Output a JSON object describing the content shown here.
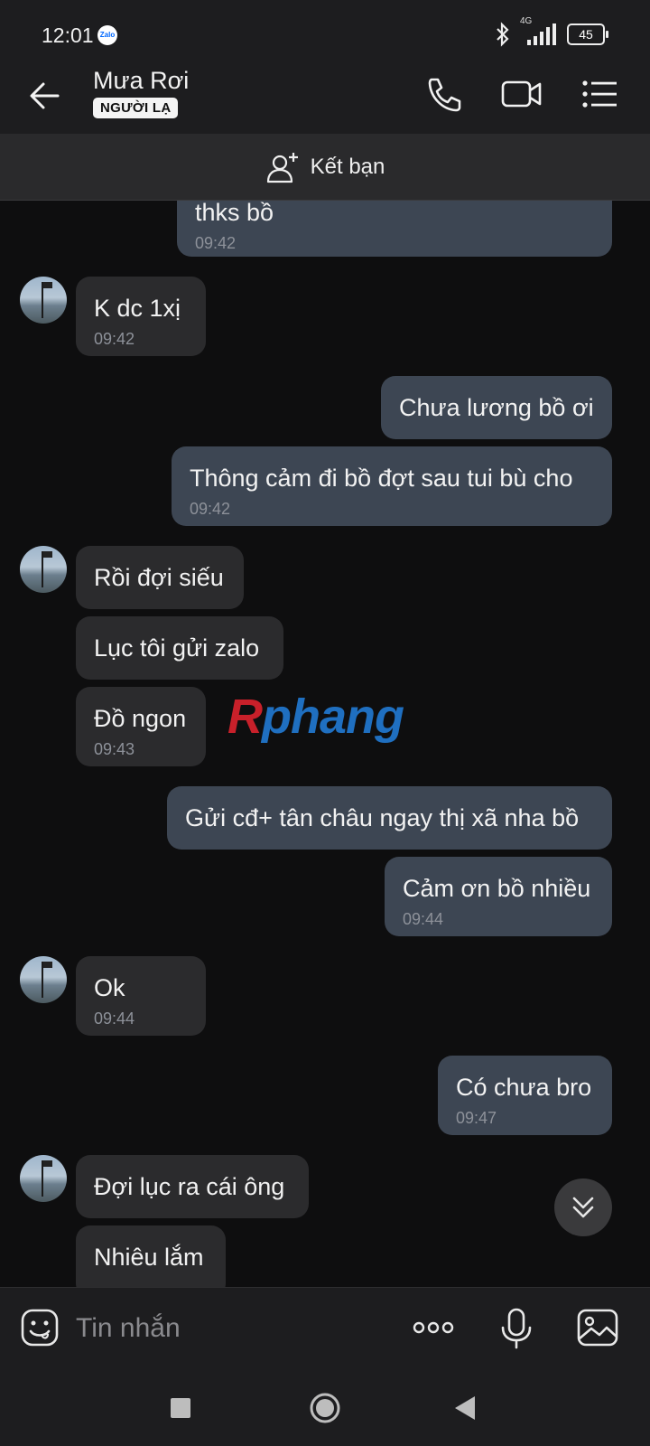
{
  "status_bar": {
    "time": "12:01",
    "zalo_label": "Zalo",
    "network": "4G",
    "battery": "45"
  },
  "header": {
    "contact_name": "Mưa Rơi",
    "stranger_badge": "NGƯỜI LẠ",
    "icons": [
      "back-arrow-icon",
      "phone-icon",
      "video-call-icon",
      "menu-list-icon"
    ]
  },
  "add_friend": {
    "label": "Kết bạn",
    "icon": "add-person-icon"
  },
  "messages": [
    {
      "dir": "out",
      "text": "thks bồ",
      "time": "09:42"
    },
    {
      "dir": "in",
      "text": "K dc 1xị",
      "time": "09:42"
    },
    {
      "dir": "out",
      "text": "Chưa lương bồ ơi",
      "time": ""
    },
    {
      "dir": "out",
      "text": "Thông cảm đi bồ đợt sau tui bù cho",
      "time": "09:42"
    },
    {
      "dir": "in",
      "text": "Rồi đợi siếu",
      "time": ""
    },
    {
      "dir": "in",
      "text": "Lục tôi gửi zalo",
      "time": ""
    },
    {
      "dir": "in",
      "text": "Đồ ngon",
      "time": "09:43"
    },
    {
      "dir": "out",
      "text": "Gửi cđ+ tân châu ngay thị xã nha bồ",
      "time": ""
    },
    {
      "dir": "out",
      "text": "Cảm ơn bồ nhiều",
      "time": "09:44"
    },
    {
      "dir": "in",
      "text": "Ok",
      "time": "09:44"
    },
    {
      "dir": "out",
      "text": "Có chưa bro",
      "time": "09:47"
    },
    {
      "dir": "in",
      "text": "Đợi lục ra cái ông",
      "time": ""
    },
    {
      "dir": "in",
      "text": "Nhiêu lắm",
      "time": ""
    }
  ],
  "watermark": {
    "first": "R",
    "rest": "phang"
  },
  "input": {
    "placeholder": "Tin nhắn",
    "icons": [
      "emoji-sticker-icon",
      "more-options-icon",
      "microphone-icon",
      "image-gallery-icon"
    ]
  },
  "nav": {
    "icons": [
      "recent-apps-icon",
      "home-icon",
      "back-icon"
    ]
  },
  "colors": {
    "background": "#0e0e0f",
    "incoming_bubble": "#2b2b2d",
    "outgoing_bubble": "#3d4653",
    "watermark_red": "#c8202a",
    "watermark_blue": "#1f6fc0"
  }
}
